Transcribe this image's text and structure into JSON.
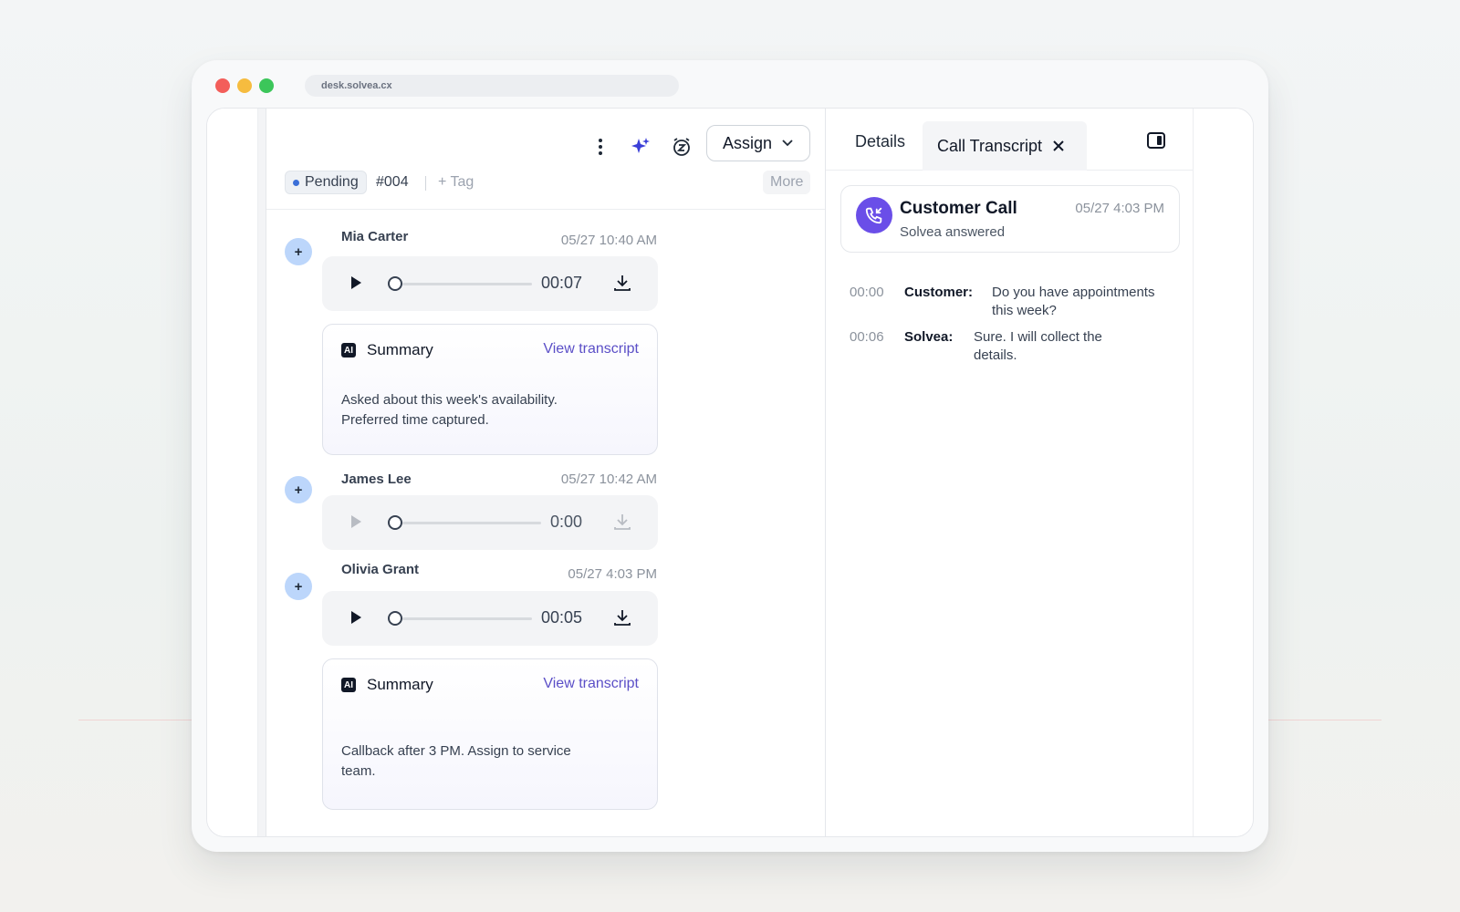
{
  "browser": {
    "url": "desk.solvea.cx"
  },
  "toolbar": {
    "assign_label": "Assign"
  },
  "ticket": {
    "status": "Pending",
    "id": "#004",
    "tag_label": "+ Tag",
    "more_label": "More"
  },
  "messages": [
    {
      "name": "Mia Carter",
      "time": "05/27 10:40 AM",
      "duration": "00:07"
    },
    {
      "name": "James Lee",
      "time": "05/27 10:42 AM",
      "duration": "0:00"
    },
    {
      "name": "Olivia Grant",
      "time": "05/27 4:03 PM",
      "duration": "00:05"
    }
  ],
  "summaries": [
    {
      "title": "Summary",
      "link": "View transcript",
      "badge": "AI",
      "body": "Asked about this week's availability. Preferred time captured."
    },
    {
      "title": "Summary",
      "link": "View transcript",
      "badge": "AI",
      "body": "Callback after 3 PM. Assign to service team."
    }
  ],
  "details": {
    "tabs": {
      "details": "Details",
      "transcript": "Call Transcript"
    },
    "call": {
      "title": "Customer Call",
      "subtitle": "Solvea answered",
      "time": "05/27 4:03 PM"
    },
    "transcript": [
      {
        "ts": "00:00",
        "speaker": "Customer:",
        "text": "Do you have appointments this week?"
      },
      {
        "ts": "00:06",
        "speaker": "Solvea:",
        "text": "Sure. I will collect the details."
      }
    ]
  },
  "colors": {
    "accent": "#6a4ee8",
    "link": "#5b4fc7",
    "status_dot": "#3b6fd8",
    "avatar": "#bcd6fb"
  },
  "icons": [
    "more-vertical-icon",
    "sparkle-icon",
    "snooze-clock-icon",
    "chevron-down-icon",
    "play-icon",
    "download-icon",
    "close-icon",
    "panel-toggle-icon",
    "phone-incoming-icon"
  ]
}
